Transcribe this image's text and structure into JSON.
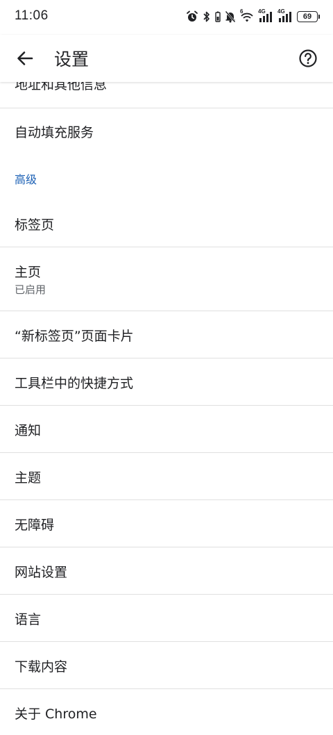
{
  "status_bar": {
    "time": "11:06",
    "wifi_label": "6",
    "sim1_label": "4G",
    "sim2_label": "4G",
    "battery": "69"
  },
  "app_bar": {
    "title": "设置",
    "back_icon": "arrow-back-icon",
    "help_icon": "help-circle-icon"
  },
  "settings": {
    "cut_off_item": "地址和其他信息",
    "autofill_service": "自动填充服务",
    "advanced_header": "高级",
    "items": [
      {
        "label": "标签页"
      },
      {
        "label": "主页",
        "sub": "已启用"
      },
      {
        "label": "“新标签页”页面卡片"
      },
      {
        "label": "工具栏中的快捷方式"
      },
      {
        "label": "通知"
      },
      {
        "label": "主题"
      },
      {
        "label": "无障碍"
      },
      {
        "label": "网站设置"
      },
      {
        "label": "语言"
      },
      {
        "label": "下载内容"
      },
      {
        "label": "关于 Chrome"
      }
    ]
  },
  "colors": {
    "accent": "#1a5fb4",
    "text": "#202124",
    "secondary_text": "#5f6368",
    "divider": "#e0e0e0"
  }
}
